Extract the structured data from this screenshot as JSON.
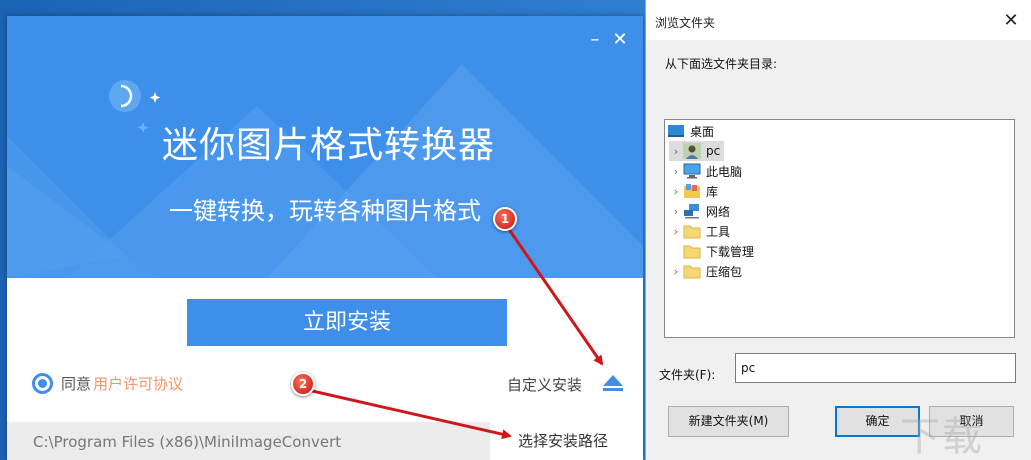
{
  "installer": {
    "title": "迷你图片格式转换器",
    "subtitle": "一键转换，玩转各种图片格式",
    "install_label": "立即安装",
    "agree_text": "同意",
    "license_link": "用户许可协议",
    "custom_install": "自定义安装",
    "install_path": "C:\\Program Files (x86)\\MiniImageConvert",
    "choose_path": "选择安装路径",
    "minimize": "–",
    "close": "✕"
  },
  "dialog": {
    "title": "浏览文件夹",
    "close": "✕",
    "prompt": "从下面选文件夹目录:",
    "tree": [
      {
        "label": "桌面",
        "icon": "desktop-icon"
      },
      {
        "label": "pc",
        "icon": "user-icon"
      },
      {
        "label": "此电脑",
        "icon": "computer-icon"
      },
      {
        "label": "库",
        "icon": "library-icon"
      },
      {
        "label": "网络",
        "icon": "network-icon"
      },
      {
        "label": "工具",
        "icon": "folder-icon"
      },
      {
        "label": "下载管理",
        "icon": "folder-icon"
      },
      {
        "label": "压缩包",
        "icon": "folder-icon"
      }
    ],
    "folder_label": "文件夹(F):",
    "folder_value": "pc",
    "new_folder": "新建文件夹(M)",
    "ok": "确定",
    "cancel": "取消"
  },
  "watermark": "下载",
  "annotations": {
    "badge1": "1",
    "badge2": "2"
  },
  "colors": {
    "accent": "#3d8fea",
    "link": "#f0956d",
    "arrow": "#d0161b"
  }
}
